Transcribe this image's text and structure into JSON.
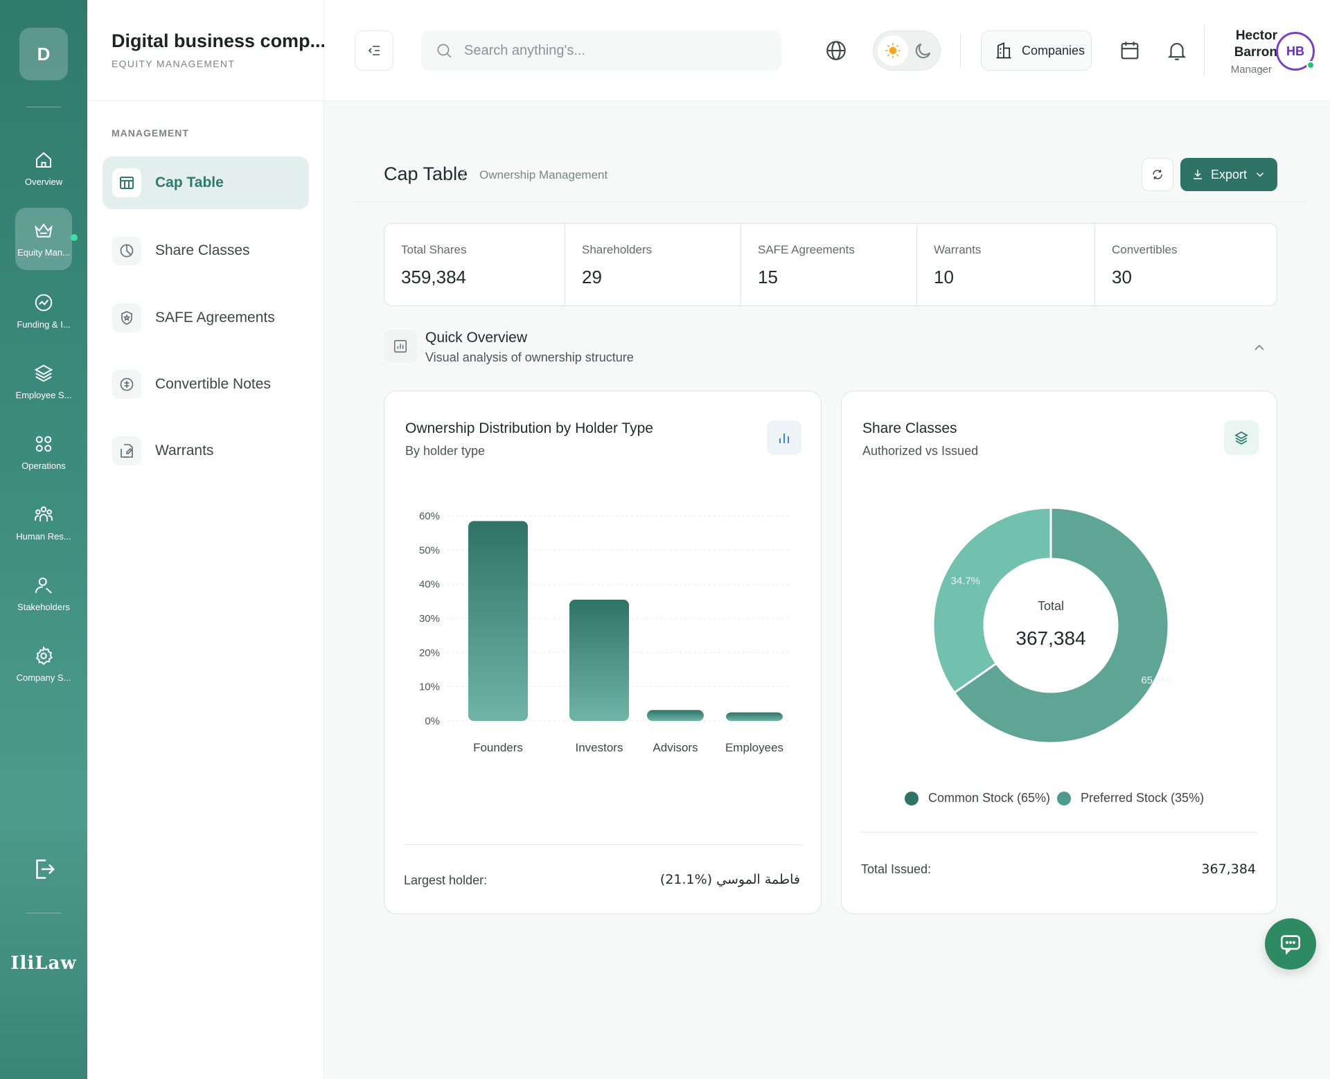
{
  "rail": {
    "avatar_letter": "D",
    "items": [
      {
        "label": "Overview",
        "icon": "home-icon"
      },
      {
        "label": "Equity Man...",
        "icon": "crown-icon"
      },
      {
        "label": "Funding & I...",
        "icon": "trend-icon"
      },
      {
        "label": "Employee S...",
        "icon": "layers-icon"
      },
      {
        "label": "Operations",
        "icon": "grid-circles-icon"
      },
      {
        "label": "Human Res...",
        "icon": "people-icon"
      },
      {
        "label": "Stakeholders",
        "icon": "user-icon"
      },
      {
        "label": "Company S...",
        "icon": "gear-icon"
      }
    ],
    "logo": "IliLaw"
  },
  "sidebar": {
    "company_name": "Digital business comp...",
    "company_section": "EQUITY MANAGEMENT",
    "section_label": "MANAGEMENT",
    "items": [
      {
        "label": "Cap Table",
        "icon": "table-icon",
        "active": true
      },
      {
        "label": "Share Classes",
        "icon": "pie-icon"
      },
      {
        "label": "SAFE Agreements",
        "icon": "shield-icon"
      },
      {
        "label": "Convertible Notes",
        "icon": "note-icon"
      },
      {
        "label": "Warrants",
        "icon": "document-icon"
      }
    ]
  },
  "header": {
    "search_placeholder": "Search anything's...",
    "companies_label": "Companies",
    "user": {
      "first_name": "Hector",
      "last_name": "Barron",
      "role": "Manager",
      "initials": "HB"
    }
  },
  "page": {
    "title": "Cap Table",
    "breadcrumb": "Ownership Management",
    "export_label": "Export"
  },
  "stats": [
    {
      "label": "Total Shares",
      "value": "359,384"
    },
    {
      "label": "Shareholders",
      "value": "29"
    },
    {
      "label": "SAFE Agreements",
      "value": "15"
    },
    {
      "label": "Warrants",
      "value": "10"
    },
    {
      "label": "Convertibles",
      "value": "30"
    }
  ],
  "overview": {
    "title": "Quick Overview",
    "subtitle": "Visual analysis of ownership structure"
  },
  "ownership_card": {
    "title": "Ownership Distribution by Holder Type",
    "subtitle": "By holder type",
    "footer_label": "Largest holder:",
    "footer_value": "فاطمة الموسي (%21.1)"
  },
  "share_card": {
    "title": "Share Classes",
    "subtitle": "Authorized vs Issued",
    "center_label": "Total",
    "center_value": "367,384",
    "legend": [
      {
        "label": "Common Stock (65%)",
        "color": "#2f7367"
      },
      {
        "label": "Preferred Stock (35%)",
        "color": "#4d9b8c"
      }
    ],
    "footer_label": "Total Issued:",
    "footer_value": "367,384"
  },
  "colors": {
    "brand": "#2f7367",
    "bar_top": "#2f7367",
    "bar_bottom": "#6fb5a6",
    "donut_common": "#5fa595",
    "donut_preferred": "#72c0ae"
  },
  "chart_data": [
    {
      "type": "bar",
      "title": "Ownership Distribution by Holder Type",
      "subtitle": "By holder type",
      "categories": [
        "Founders",
        "Investors",
        "Advisors",
        "Employees"
      ],
      "values": [
        58.5,
        35.5,
        3.2,
        2.5
      ],
      "ylim": [
        0,
        60
      ],
      "yticks": [
        "0%",
        "10%",
        "20%",
        "30%",
        "40%",
        "50%",
        "60%"
      ],
      "grid": true
    },
    {
      "type": "pie",
      "title": "Share Classes",
      "subtitle": "Authorized vs Issued",
      "categories": [
        "Common Stock",
        "Preferred Stock"
      ],
      "values": [
        65.3,
        34.7
      ],
      "labels": [
        "65.3%",
        "34.7%"
      ],
      "donut": true
    }
  ]
}
